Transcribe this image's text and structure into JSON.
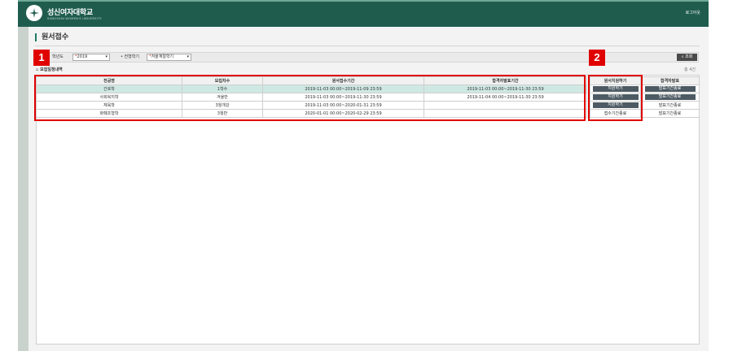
{
  "header": {
    "brand": "성신여자대학교",
    "brand_sub": "SUNGSHIN WOMEN'S UNIVERSITY",
    "logout": "로그아웃"
  },
  "page": {
    "title": "원서접수"
  },
  "search": {
    "year_label": "학년도",
    "year_value": "2019",
    "term_label": "• 전형학기",
    "term_value": "겨울계절학기",
    "button": "조회"
  },
  "section": {
    "label": "모집일정내역",
    "count": "총 4건"
  },
  "table": {
    "headers": [
      "전공명",
      "모집차수",
      "원서접수기간",
      "합격자발표기간"
    ],
    "rows": [
      [
        "간호학",
        "1학수",
        "2019-11-03 00:00~2019-11-09 23:59",
        "2019-11-03 00:00~2019-11-30 23:59"
      ],
      [
        "사회복지학",
        "겨울반",
        "2019-11-03 00:00~2019-11-30 23:59",
        "2019-11-04 00:00~2019-11-30 23:59"
      ],
      [
        "체육학",
        "3월개강",
        "2019-11-03 00:00~2020-01-31 23:59",
        ""
      ],
      [
        "화훼조형학",
        "3월반",
        "2020-01-01 00:00~2020-02-29 23:59",
        ""
      ]
    ]
  },
  "actions": {
    "apply_header": "원서지원하기",
    "result_header": "합격자발표",
    "apply": [
      "지원하기",
      "지원하기",
      "지원하기",
      "접수기간종료"
    ],
    "result": [
      "발표기간종료",
      "발표기간종료",
      "발표기간종료",
      "발표기간종료"
    ]
  },
  "annotations": {
    "badge1": "1",
    "badge2": "2"
  },
  "colors": {
    "header_bg": "#1f5c4e",
    "highlight_row": "#cfe8e2",
    "annotation_red": "#e00000",
    "button_dark": "#4d5a63"
  }
}
